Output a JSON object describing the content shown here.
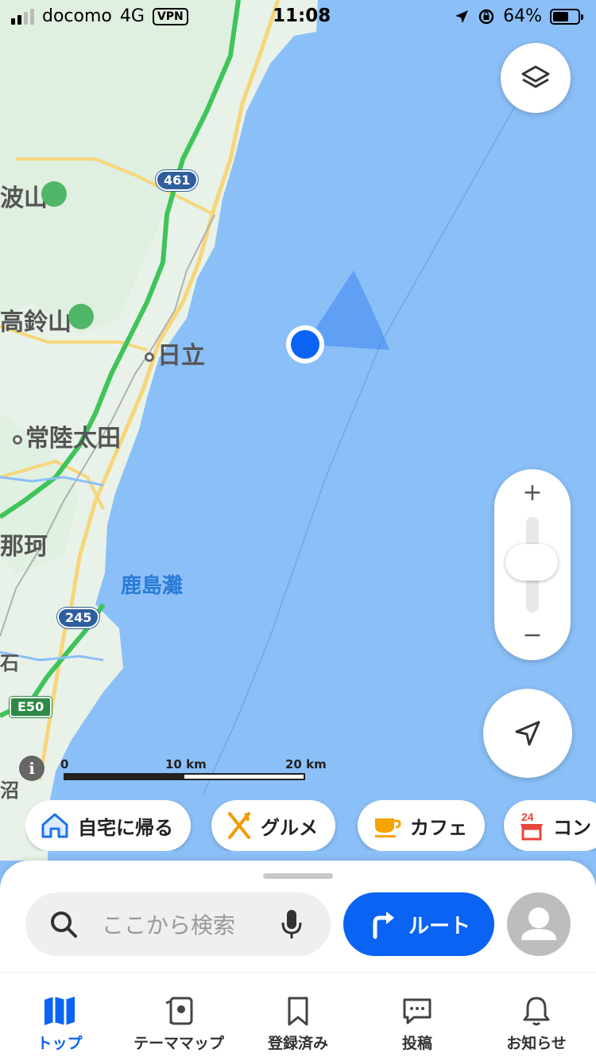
{
  "status_bar": {
    "carrier": "docomo",
    "network": "4G",
    "vpn": "VPN",
    "time": "11:08",
    "battery": "64%",
    "battery_level": 0.64
  },
  "map": {
    "labels": {
      "mt_tsukuba": "波山",
      "mt_takasuzu": "高鈴山",
      "hitachi": "日立",
      "hitachiota": "常陸太田",
      "naka": "那珂",
      "kashimanada": "鹿島灘",
      "ishi": "石",
      "numa": "沼"
    },
    "route_shields": {
      "r461": "461",
      "r245": "245",
      "e50": "E50"
    },
    "scale": {
      "zero": "0",
      "mid": "10 km",
      "max": "20 km"
    },
    "colors": {
      "sea": "#8bbff7",
      "land": "#e8f2e9",
      "expressway": "#3ec45a",
      "road": "#f7d67a",
      "location": "#0a63f2"
    }
  },
  "controls": {
    "layers_icon": "layers-icon",
    "zoom_in": "+",
    "zoom_out": "−",
    "locate_icon": "navigation-arrow-icon"
  },
  "chips": [
    {
      "label": "自宅に帰る",
      "icon": "home-icon"
    },
    {
      "label": "グルメ",
      "icon": "fork-knife-icon"
    },
    {
      "label": "カフェ",
      "icon": "cup-icon"
    },
    {
      "label": "コン",
      "icon": "convenience-store-icon"
    }
  ],
  "search": {
    "placeholder": "ここから検索",
    "route_label": "ルート"
  },
  "tabs": [
    {
      "label": "トップ",
      "active": true
    },
    {
      "label": "テーママップ",
      "active": false
    },
    {
      "label": "登録済み",
      "active": false
    },
    {
      "label": "投稿",
      "active": false
    },
    {
      "label": "お知らせ",
      "active": false
    }
  ]
}
